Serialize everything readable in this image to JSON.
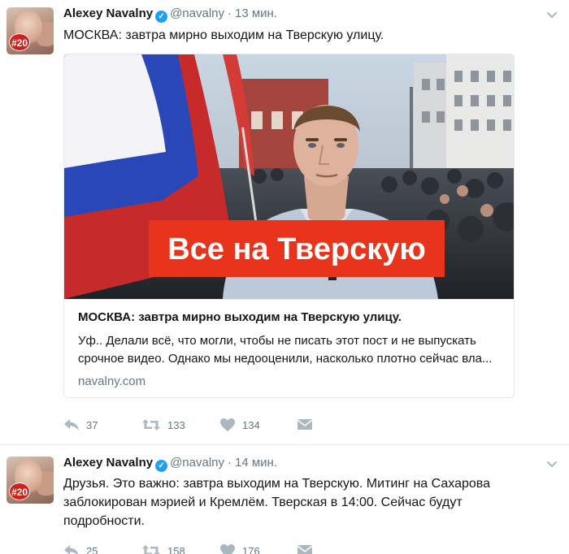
{
  "tweets": [
    {
      "name": "Alexey Navalny",
      "handle": "@navalny",
      "separator": "·",
      "time": "13 мин.",
      "avatar_badge": "#20",
      "text": "МОСКВА: завтра мирно выходим на Тверскую улицу.",
      "card": {
        "image_banner": "Все на Тверскую",
        "title": "МОСКВА: завтра мирно выходим на Тверскую улицу.",
        "description": "Уф.. Делали всё, что могли, чтобы не писать этот пост и не выпускать срочное видео. Однако мы недооценили, насколько плотно сейчас вла...",
        "domain": "navalny.com"
      },
      "stats": {
        "replies": "37",
        "retweets": "133",
        "likes": "134"
      }
    },
    {
      "name": "Alexey Navalny",
      "handle": "@navalny",
      "separator": "·",
      "time": "14 мин.",
      "avatar_badge": "#20",
      "text": "Друзья. Это важно: завтра выходим на Тверскую. Митинг на Сахарова заблокирован мэрией и Кремлём. Тверская в 14:00. Сейчас будут подробности.",
      "stats": {
        "replies": "25",
        "retweets": "158",
        "likes": "176"
      }
    }
  ],
  "icons": {
    "verified": "verified-badge-icon",
    "caret": "chevron-down-icon",
    "reply": "reply-icon",
    "retweet": "retweet-icon",
    "like": "heart-icon",
    "dm": "direct-message-icon"
  },
  "colors": {
    "text": "#14171a",
    "secondary": "#657786",
    "action_icon": "#aab8c2",
    "verified": "#1da1f2",
    "banner": "#e8341c",
    "avatar_badge": "#d0211c"
  }
}
